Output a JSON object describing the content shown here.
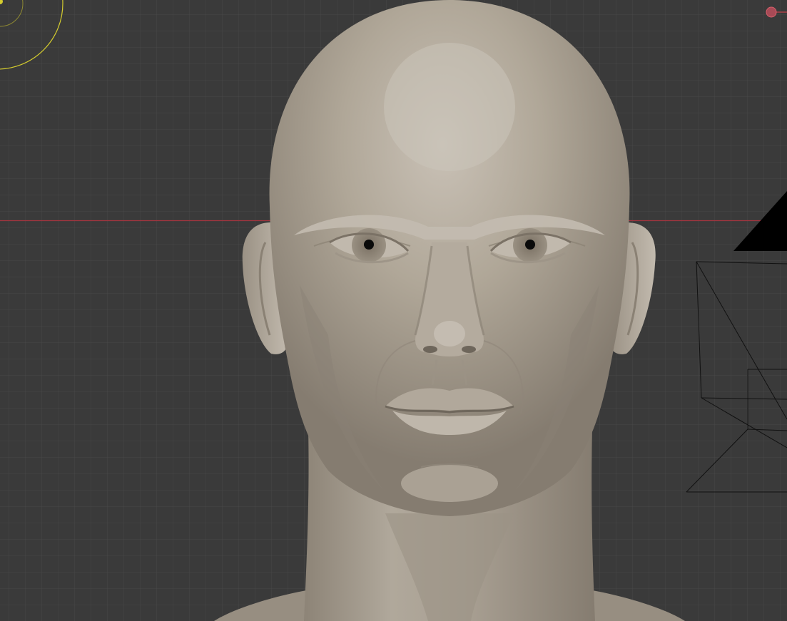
{
  "viewport": {
    "background": "#3a3a3a",
    "grid_minor_color": "#444444",
    "grid_major_color": "#4a4a4a",
    "x_axis_color": "#a4343f",
    "skin_color": "#aea597",
    "light_gizmo_color": "#d4cc2e",
    "object_origin_color": "#c8404a"
  },
  "scene_objects": [
    "head-sculpt",
    "camera",
    "light"
  ]
}
